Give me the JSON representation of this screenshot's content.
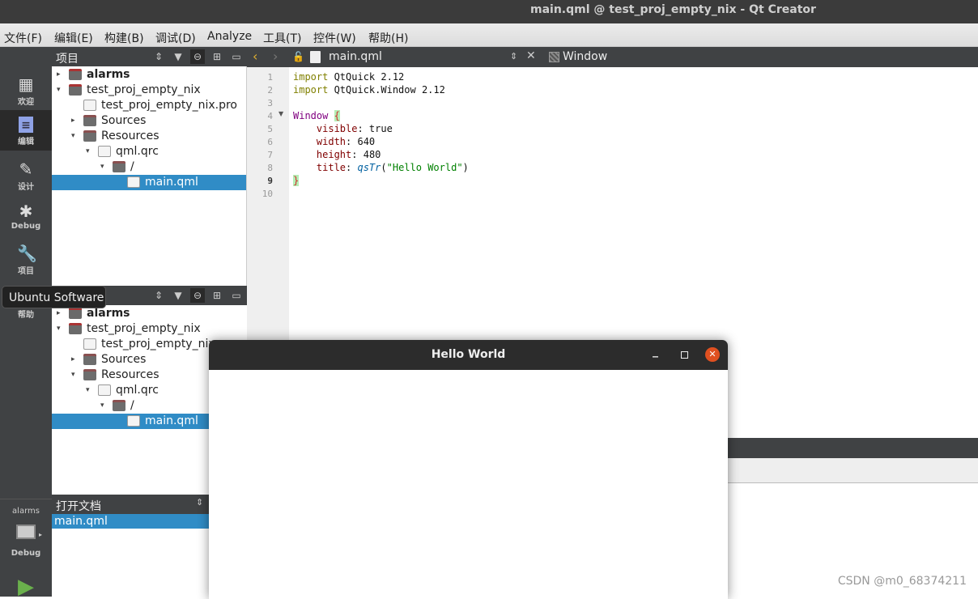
{
  "window": {
    "title": "main.qml @ test_proj_empty_nix - Qt Creator"
  },
  "menu": [
    "文件(F)",
    "编辑(E)",
    "构建(B)",
    "调试(D)",
    "Analyze",
    "工具(T)",
    "控件(W)",
    "帮助(H)"
  ],
  "modes": [
    {
      "label": "欢迎",
      "icon": "grid-icon"
    },
    {
      "label": "编辑",
      "icon": "edit-doc-icon"
    },
    {
      "label": "设计",
      "icon": "pencil-icon"
    },
    {
      "label": "Debug",
      "icon": "bug-icon"
    },
    {
      "label": "项目",
      "icon": "wrench-icon"
    },
    {
      "label": "帮助",
      "icon": "help-icon"
    }
  ],
  "kit": {
    "project": "alarms",
    "build": "Debug"
  },
  "projects_panel": {
    "title": "项目"
  },
  "tree": [
    {
      "label": "alarms",
      "depth": 0,
      "arrow": "▸",
      "icon": "proj",
      "bold": true
    },
    {
      "label": "test_proj_empty_nix",
      "depth": 0,
      "arrow": "▾",
      "icon": "proj"
    },
    {
      "label": "test_proj_empty_nix.pro",
      "depth": 1,
      "arrow": "",
      "icon": "file"
    },
    {
      "label": "Sources",
      "depth": 1,
      "arrow": "▸",
      "icon": "folder"
    },
    {
      "label": "Resources",
      "depth": 1,
      "arrow": "▾",
      "icon": "folder"
    },
    {
      "label": "qml.qrc",
      "depth": 2,
      "arrow": "▾",
      "icon": "file"
    },
    {
      "label": "/",
      "depth": 3,
      "arrow": "▾",
      "icon": "folder"
    },
    {
      "label": "main.qml",
      "depth": 4,
      "arrow": "",
      "icon": "file",
      "selected": true
    }
  ],
  "open_docs": {
    "title": "打开文档",
    "items": [
      "main.qml"
    ]
  },
  "editor": {
    "file": "main.qml",
    "symbol": "Window",
    "line_numbers": [
      "1",
      "2",
      "3",
      "4",
      "5",
      "6",
      "7",
      "8",
      "9",
      "10"
    ],
    "current_line": "9"
  },
  "tooltip": "Ubuntu Software",
  "app_window": {
    "title": "Hello World"
  },
  "watermark": "CSDN @m0_68374211"
}
